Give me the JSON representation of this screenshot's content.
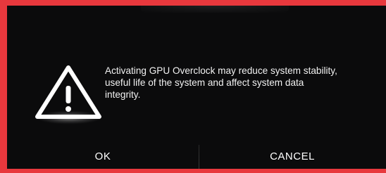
{
  "dialog": {
    "message": "Activating GPU Overclock may reduce system stability,\nuseful life of the system and affect system data\nintegrity.",
    "icon": "warning-icon"
  },
  "buttons": {
    "ok_label": "OK",
    "cancel_label": "CANCEL"
  },
  "colors": {
    "border": "#e8383d",
    "background": "#0b0b0c",
    "text": "#ffffff"
  }
}
